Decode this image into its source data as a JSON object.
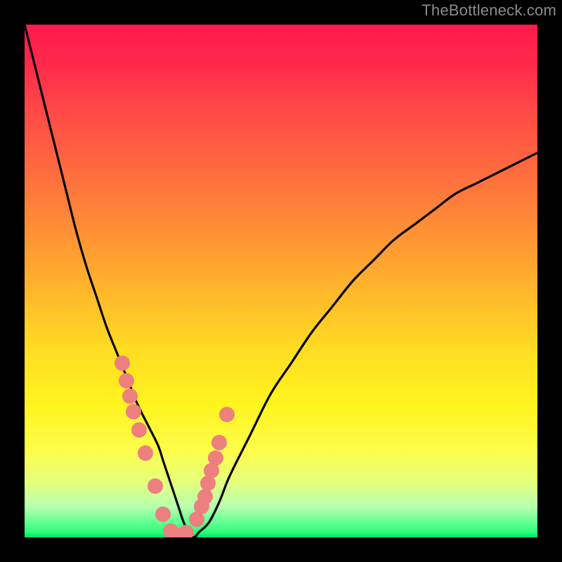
{
  "watermark": "TheBottleneck.com",
  "chart_data": {
    "type": "line",
    "title": "",
    "xlabel": "",
    "ylabel": "",
    "xlim": [
      0,
      100
    ],
    "ylim": [
      0,
      100
    ],
    "grid": false,
    "series": [
      {
        "name": "bottleneck-curve",
        "x": [
          0,
          2,
          4,
          6,
          8,
          10,
          12,
          14,
          16,
          18,
          20,
          22,
          24,
          26,
          27,
          28,
          29,
          30,
          31,
          32,
          33,
          34,
          36,
          38,
          40,
          44,
          48,
          52,
          56,
          60,
          64,
          68,
          72,
          76,
          80,
          84,
          88,
          92,
          96,
          100
        ],
        "y": [
          100,
          92,
          84,
          76,
          68,
          60,
          53,
          47,
          41,
          36,
          31,
          26,
          22,
          18,
          15,
          12,
          9,
          6,
          3,
          1,
          0,
          1,
          3,
          7,
          12,
          20,
          28,
          34,
          40,
          45,
          50,
          54,
          58,
          61,
          64,
          67,
          69,
          71,
          73,
          75
        ]
      }
    ],
    "highlight_points": {
      "name": "data-dots",
      "x": [
        19.0,
        19.8,
        20.6,
        21.3,
        22.3,
        23.5,
        25.5,
        27.0,
        28.5,
        30.0,
        31.5,
        33.5,
        34.5,
        35.2,
        35.8,
        36.5,
        37.2,
        38.0,
        39.4
      ],
      "y": [
        34.0,
        30.5,
        27.5,
        24.5,
        21.0,
        16.5,
        10.0,
        4.5,
        1.2,
        0.4,
        1.0,
        3.5,
        6.0,
        8.0,
        10.5,
        13.0,
        15.5,
        18.5,
        24.0
      ]
    },
    "background_gradient": {
      "top_color": "#ff1a4d",
      "mid_color": "#ffde22",
      "bottom_color": "#00e26a"
    }
  }
}
